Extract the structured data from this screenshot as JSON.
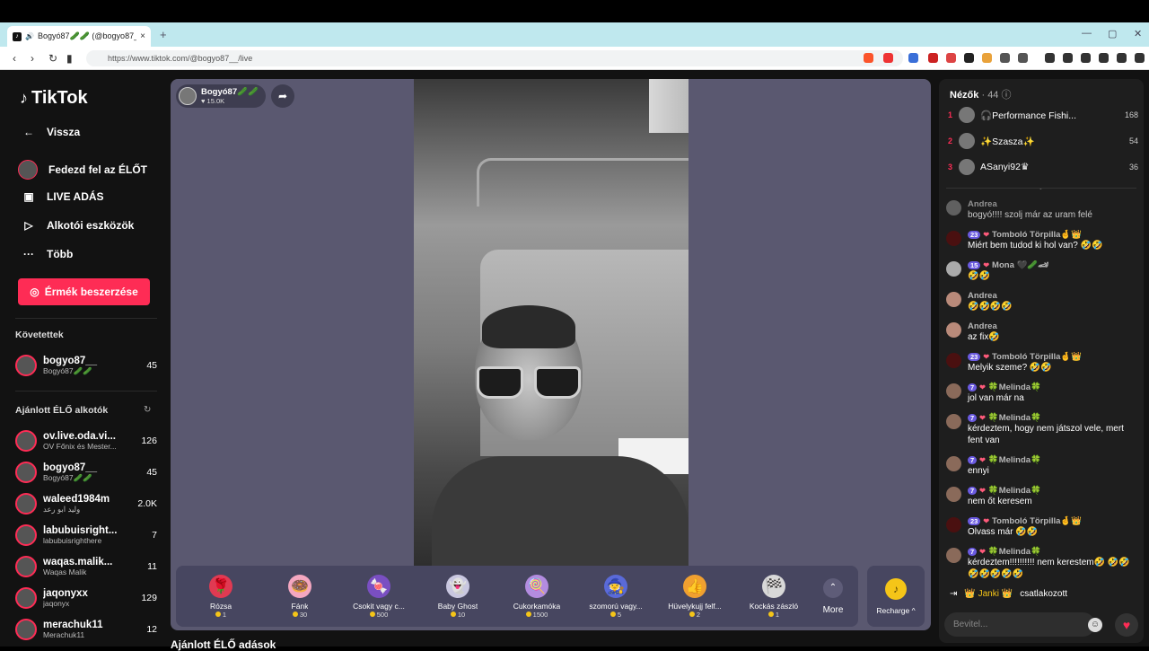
{
  "browser": {
    "tab_title": "Bogyó87🥒🥒 (@bogyo87__",
    "url": "https://www.tiktok.com/@bogyo87__/live",
    "new_tab": "+",
    "close_tab": "×"
  },
  "sidebar": {
    "logo": "TikTok",
    "back": "Vissza",
    "menu": [
      {
        "label": "Fedezd fel az ÉLŐT"
      },
      {
        "label": "LIVE ADÁS"
      },
      {
        "label": "Alkotói eszközök"
      },
      {
        "label": "Több"
      }
    ],
    "coins_button": "Érmék beszerzése",
    "following_title": "Követettek",
    "following": [
      {
        "name": "bogyo87__",
        "sub": "Bogyó87🥒🥒",
        "count": "45"
      }
    ],
    "recommended_title": "Ajánlott ÉLŐ alkotók",
    "recommended": [
      {
        "name": "ov.live.oda.vi...",
        "sub": "OV Főnix és Mester...",
        "count": "126"
      },
      {
        "name": "bogyo87__",
        "sub": "Bogyó87🥒🥒",
        "count": "45"
      },
      {
        "name": "waleed1984m",
        "sub": "وليد ابو رعد",
        "count": "2.0K"
      },
      {
        "name": "labubuisright...",
        "sub": "labubuisrighthere",
        "count": "7"
      },
      {
        "name": "waqas.malik...",
        "sub": "Waqas Malik",
        "count": "11"
      },
      {
        "name": "jaqonyxx",
        "sub": "jaqonyx",
        "count": "129"
      },
      {
        "name": "merachuk11",
        "sub": "Merachuk11",
        "count": "12"
      }
    ]
  },
  "stage": {
    "host_name": "Bogyó87🥒🥒",
    "host_likes": "♥ 15.0K",
    "gifts": [
      {
        "name": "Rózsa",
        "price": "1",
        "icon": "rose-icon",
        "glyph": "🌹",
        "color": "#e03a52"
      },
      {
        "name": "Fánk",
        "price": "30",
        "icon": "donut-icon",
        "glyph": "🍩",
        "color": "#f4a7c0"
      },
      {
        "name": "Csokit vagy c...",
        "price": "500",
        "icon": "candy-icon",
        "glyph": "🍬",
        "color": "#7a4fc2"
      },
      {
        "name": "Baby Ghost",
        "price": "10",
        "icon": "ghost-icon",
        "glyph": "👻",
        "color": "#c9c7e0"
      },
      {
        "name": "Cukorkamóka",
        "price": "1500",
        "icon": "candy-ghost-icon",
        "glyph": "🍭",
        "color": "#b38ce0"
      },
      {
        "name": "szomorú vagy...",
        "price": "5",
        "icon": "wizard-icon",
        "glyph": "🧙",
        "color": "#5a6ad8"
      },
      {
        "name": "Hüvelykujj felf...",
        "price": "2",
        "icon": "thumbs-up-icon",
        "glyph": "👍",
        "color": "#f0a030"
      },
      {
        "name": "Kockás zászló",
        "price": "1",
        "icon": "checkered-flag-icon",
        "glyph": "🏁",
        "color": "#d8d8d8"
      }
    ],
    "more_label": "More",
    "recharge_label": "Recharge ^",
    "below_title": "Ajánlott ÉLŐ adások"
  },
  "chat": {
    "viewers_label": "Nézők",
    "viewers_count": "· 44",
    "top_viewers": [
      {
        "rank": "1",
        "name": "🎧Performance Fishi...",
        "score": "168"
      },
      {
        "rank": "2",
        "name": "✨Szasza✨",
        "score": "54"
      },
      {
        "rank": "3",
        "name": "ASanyi92♛",
        "score": "36"
      }
    ],
    "messages": [
      {
        "user": "Andrea",
        "text": "bogyó!!!! szolj már az uram felé",
        "level": "",
        "faded": true
      },
      {
        "user": "Tomboló Törpilla🤞👑",
        "text": "Miért bem tudod ki hol van? 🤣🤣",
        "level": "23"
      },
      {
        "user": "Mona 🖤🥒🏎",
        "text": "🤣🤣",
        "level": "15"
      },
      {
        "user": "Andrea",
        "text": "🤣🤣🤣🤣",
        "level": ""
      },
      {
        "user": "Andrea",
        "text": "az fix🤣",
        "level": ""
      },
      {
        "user": "Tomboló Törpilla🤞👑",
        "text": "Melyik szeme? 🤣🤣",
        "level": "23"
      },
      {
        "user": "🍀Melinda🍀",
        "text": "jol van már na",
        "level": "7"
      },
      {
        "user": "🍀Melinda🍀",
        "text": "kérdeztem, hogy nem játszol vele, mert fent van",
        "level": "7"
      },
      {
        "user": "🍀Melinda🍀",
        "text": "ennyi",
        "level": "7"
      },
      {
        "user": "🍀Melinda🍀",
        "text": "nem őt keresem",
        "level": "7"
      },
      {
        "user": "Tomboló Törpilla🤞👑",
        "text": "Olvass már 🤣🤣",
        "level": "23"
      },
      {
        "user": "🍀Melinda🍀",
        "text": "kérdeztem!!!!!!!!!! nem kerestem🤣 🤣🤣🤣🤣🤣🤣🤣",
        "level": "7"
      }
    ],
    "joined_user": "👑 Janki 👑",
    "joined_text": "csatlakozott",
    "input_placeholder": "Bevitel..."
  }
}
